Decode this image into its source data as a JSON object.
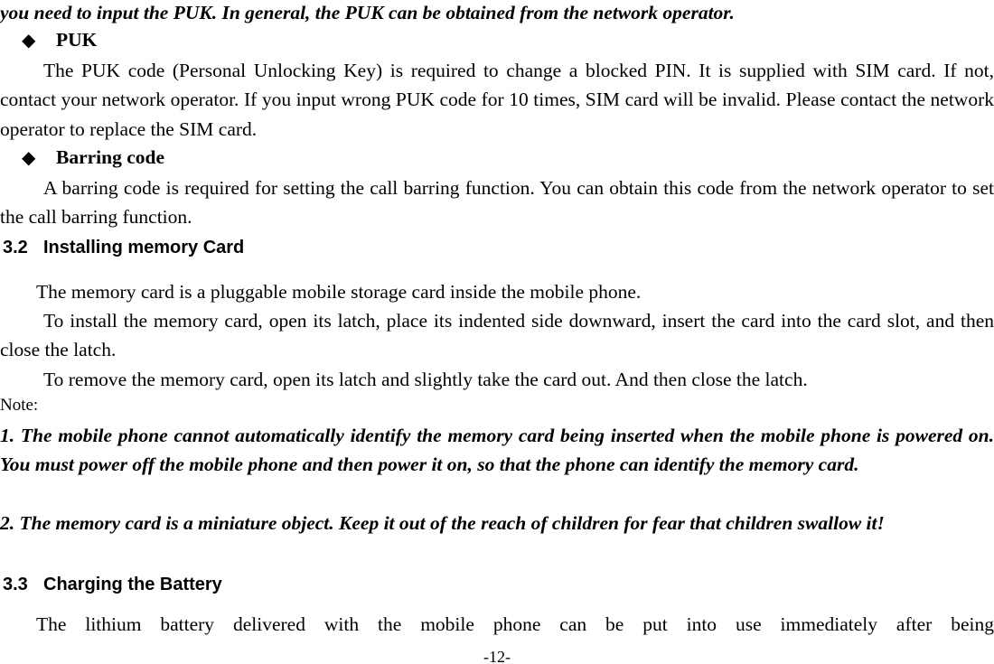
{
  "page": {
    "footer": "-12-",
    "number": 12
  },
  "content": {
    "continued_line": "you need to input the PUK. In general, the PUK can be obtained from the network operator.",
    "bullet_glyph": "◆",
    "puk": {
      "label": "PUK",
      "body": "The PUK code (Personal Unlocking Key) is required to change a blocked PIN. It is supplied with SIM card. If not, contact your network operator. If you input wrong PUK code for 10 times, SIM card will be invalid. Please contact the network operator to replace the SIM card."
    },
    "barring": {
      "label": "Barring code",
      "body": "A barring code is required for setting the call barring function. You can obtain this code from the network operator to set the call barring function."
    },
    "section_3_2": {
      "number": "3.2",
      "title": "Installing memory Card",
      "para1": "The memory card is a pluggable mobile storage card inside the mobile phone.",
      "para2": "To install the memory card, open its latch, place its indented side downward, insert the card into the card slot, and then close the latch.",
      "para3": "To remove the memory card, open its latch and slightly take the card out. And then close the latch.",
      "note_label": "Note:",
      "note1": "1. The mobile phone cannot automatically identify the memory card being inserted when the mobile phone is powered on. You must power off the mobile phone and then power it on, so that the phone can identify the memory card.",
      "note2": "2. The memory card is a miniature object. Keep it out of the reach of children for fear that children swallow it!"
    },
    "section_3_3": {
      "number": "3.3",
      "title": "Charging the Battery",
      "para1": "The lithium battery delivered with the mobile phone can be put into use immediately after being"
    }
  }
}
